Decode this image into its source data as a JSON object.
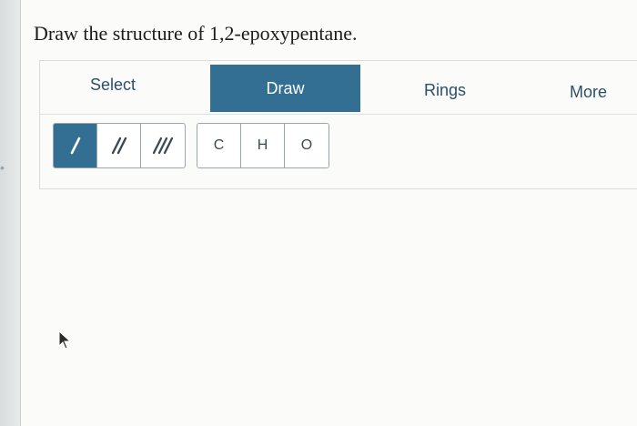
{
  "question": "Draw the structure of 1,2-epoxypentane.",
  "tabs": {
    "select": "Select",
    "draw": "Draw",
    "rings": "Rings",
    "more": "More"
  },
  "bond_tools": [
    {
      "icon": "single-bond-icon",
      "active": true
    },
    {
      "icon": "double-bond-icon",
      "active": false
    },
    {
      "icon": "triple-bond-icon",
      "active": false
    }
  ],
  "atom_tools": [
    "C",
    "H",
    "O"
  ],
  "colors": {
    "accent": "#336f93",
    "tab_text": "#2c4f6a",
    "border": "#9aa6ab"
  }
}
